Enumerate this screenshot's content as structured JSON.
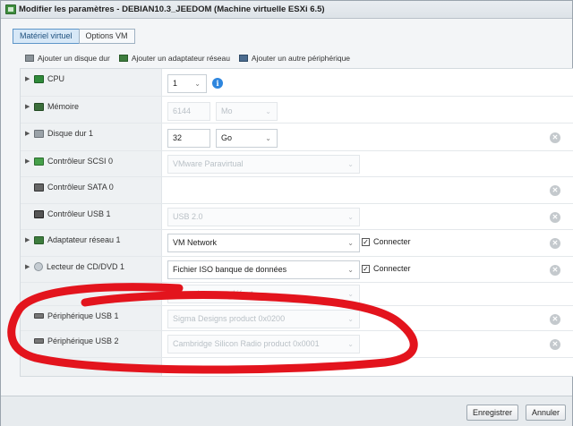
{
  "window": {
    "title": "Modifier les paramètres - DEBIAN10.3_JEEDOM (Machine virtuelle ESXi 6.5)"
  },
  "tabs": [
    {
      "label": "Matériel virtuel",
      "active": true
    },
    {
      "label": "Options VM",
      "active": false
    }
  ],
  "toolbar": {
    "add_disk": "Ajouter un disque dur",
    "add_nic": "Ajouter un adaptateur réseau",
    "add_device": "Ajouter un autre périphérique"
  },
  "rows": {
    "cpu": {
      "label": "CPU",
      "value": "1"
    },
    "memory": {
      "label": "Mémoire",
      "value": "6144",
      "unit": "Mo"
    },
    "disk": {
      "label": "Disque dur 1",
      "value": "32",
      "unit": "Go"
    },
    "scsi": {
      "label": "Contrôleur SCSI 0",
      "value": "VMware Paravirtual"
    },
    "sata": {
      "label": "Contrôleur SATA 0"
    },
    "usbctrl": {
      "label": "Contrôleur USB 1",
      "value": "USB 2.0"
    },
    "nic": {
      "label": "Adaptateur réseau 1",
      "value": "VM Network",
      "connect": "Connecter"
    },
    "cd": {
      "label": "Lecteur de CD/DVD 1",
      "value": "Fichier ISO banque de données",
      "connect": "Connecter"
    },
    "video": {
      "value": "Paramètres par défaut"
    },
    "usb1": {
      "label": "Périphérique USB 1",
      "value": "Sigma Designs product 0x0200"
    },
    "usb2": {
      "label": "Périphérique USB 2",
      "value": "Cambridge Silicon Radio product 0x0001"
    }
  },
  "footer": {
    "save": "Enregistrer",
    "cancel": "Annuler"
  },
  "icons": {
    "info": "info-icon",
    "remove": "remove-icon",
    "check": "checkmark"
  },
  "colors": {
    "accent": "#2e86de",
    "annotation": "#e3141d"
  }
}
